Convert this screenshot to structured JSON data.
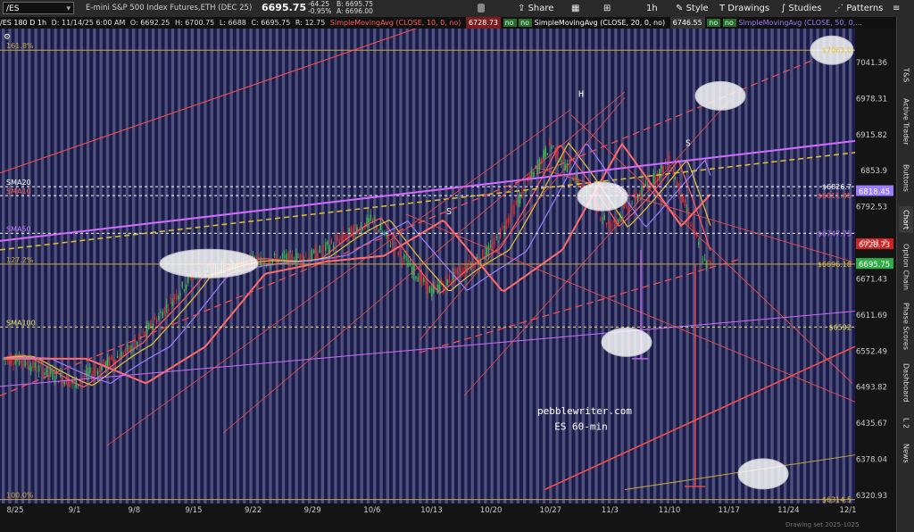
{
  "toolbar": {
    "symbol": "/ES",
    "description": "E-mini S&P 500 Index Futures,ETH (DEC 25)",
    "last": "6695.75",
    "change": "-64.25",
    "change_pct": "-0.95%",
    "bid": "B: 6695.75",
    "ask": "A: 6696.00",
    "share": "Share",
    "timeframe": "1h",
    "style": "Style",
    "drawings": "Drawings",
    "studies": "Studies",
    "patterns": "Patterns"
  },
  "infoline": {
    "period": "/ES 180 D 1h",
    "date": "D: 11/14/25 6:00 AM",
    "open": "O: 6692.25",
    "high": "H: 6700.75",
    "low": "L: 6688",
    "close": "C: 6695.75",
    "range": "R: 12.75",
    "sma10_label": "SimpleMovingAvg (CLOSE, 10, 0, no)",
    "sma10_value": "6728.73",
    "sma20_label": "SimpleMovingAvg (CLOSE, 20, 0, no)",
    "sma20_value": "6746.55",
    "sma50_label": "SimpleMovingAvg (CLOSE, 50, 0,...",
    "no": "no"
  },
  "sidepanel": [
    "T&S",
    "Active Trader",
    "Buttons",
    "Chart",
    "Option Chain",
    "Phase Scores",
    "Dashboard",
    "L 2",
    "News"
  ],
  "colors": {
    "bg": "#1b1c4d",
    "stripe": "#bfc3d8",
    "candle_up": "#3fbf4f",
    "candle_down": "#d93030",
    "sma10": "#ff5b5b",
    "sma20": "#e8c23a",
    "sma50": "#9b7cff",
    "sma100": "#ff6b6b",
    "purple_line": "#d36bff",
    "fib_line": "#c8a640",
    "trend_line": "#ff4d4d"
  },
  "chart_data": {
    "type": "line",
    "title": "/ES 180 D 1h",
    "x_ticks": [
      "8/25",
      "9/1",
      "9/8",
      "9/15",
      "9/22",
      "9/29",
      "10/6",
      "10/13",
      "10/20",
      "10/27",
      "11/3",
      "11/10",
      "11/17",
      "11/24",
      "12/1"
    ],
    "y_ticks": [
      7041.36,
      6978.31,
      6915.82,
      6853.9,
      6792.53,
      6731.7,
      6671.43,
      6611.69,
      6552.49,
      6493.82,
      6435.67,
      6378.04,
      6320.93
    ],
    "ylim": [
      6300,
      7100
    ],
    "scale": "log",
    "price_close_approx": {
      "x": [
        "8/25",
        "9/1",
        "9/8",
        "9/15",
        "9/22",
        "9/29",
        "10/6",
        "10/13",
        "10/20",
        "10/27",
        "11/3",
        "11/10",
        "11/14"
      ],
      "y": [
        6540,
        6500,
        6560,
        6680,
        6700,
        6710,
        6770,
        6650,
        6720,
        6900,
        6760,
        6870,
        6696
      ]
    },
    "price_labels": [
      {
        "text": "$6826.7",
        "value": 6826.7
      },
      {
        "text": "$6811.45",
        "value": 6811.45
      },
      {
        "text": "6818.45",
        "value": 6818.45
      },
      {
        "text": "$6747.75",
        "value": 6747.75
      },
      {
        "text": "6728.73",
        "value": 6728.73
      },
      {
        "text": "$6696.18",
        "value": 6696.18
      },
      {
        "text": "6695.75",
        "value": 6695.75
      },
      {
        "text": "$6592",
        "value": 6592
      },
      {
        "text": "$6314.5",
        "value": 6314.5
      },
      {
        "text": "$7063.0",
        "value": 7063
      }
    ],
    "left_labels": [
      {
        "text": "161.8%",
        "value": 7063
      },
      {
        "text": "SMA20",
        "value": 6826.7
      },
      {
        "text": "SMA10",
        "value": 6811.45
      },
      {
        "text": "SMA50",
        "value": 6747.75
      },
      {
        "text": "127.2%",
        "value": 6696.18
      },
      {
        "text": "SMA100",
        "value": 6592
      },
      {
        "text": "100.0%",
        "value": 6314.5
      }
    ],
    "annotations": [
      {
        "text": "H",
        "value": 6975
      },
      {
        "text": "S",
        "value": 6780
      },
      {
        "text": "S",
        "value": 6890
      },
      {
        "text": "pebblewriter.com",
        "value": 6450
      },
      {
        "text": "ES 60-min",
        "value": 6425
      }
    ]
  },
  "status": "Drawing set 2025-1025"
}
